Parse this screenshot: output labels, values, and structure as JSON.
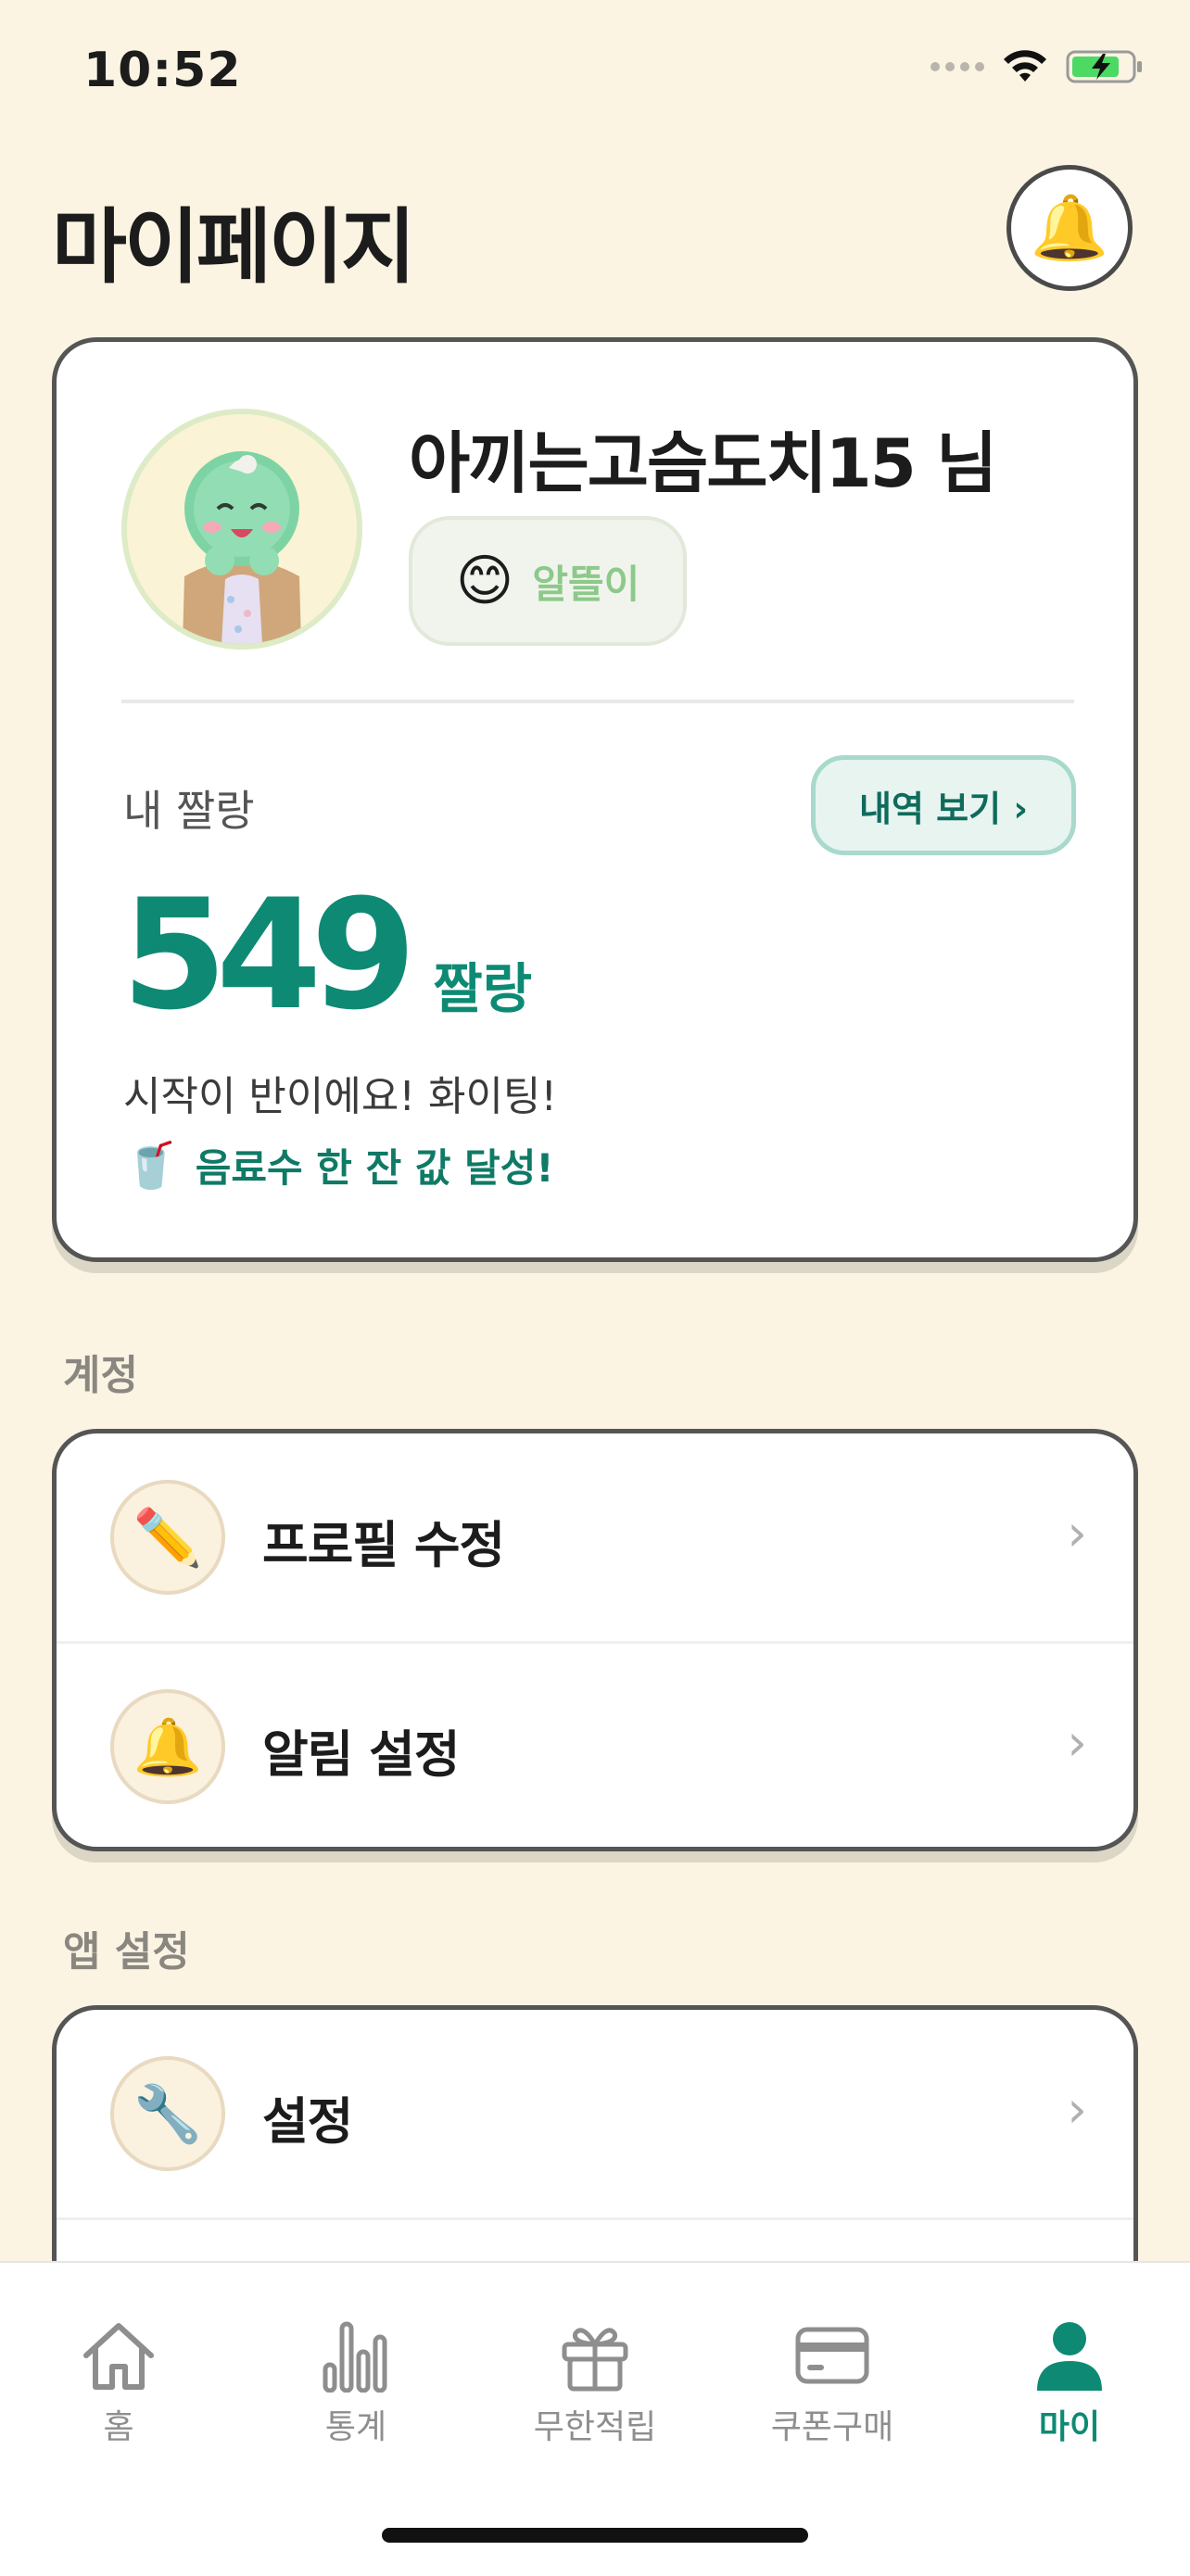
{
  "status_bar": {
    "time": "10:52"
  },
  "header": {
    "title": "마이페이지",
    "notification_icon": "bell-icon"
  },
  "profile": {
    "username": "아끼는고슴도치15 님",
    "badge_emoji": "😊",
    "badge_label": "알뜰이",
    "points_label": "내 짤랑",
    "history_button": "내역 보기 ›",
    "points_value": "549",
    "points_unit": "짤랑",
    "message": "시작이 반이에요! 화이팅!",
    "achievement_icon": "🥤",
    "achievement_text": "음료수 한 잔 값 달성!"
  },
  "sections": {
    "account": {
      "title": "계정",
      "items": [
        {
          "label": "프로필 수정",
          "icon": "✏️"
        },
        {
          "label": "알림 설정",
          "icon": "🔔"
        }
      ]
    },
    "app_settings": {
      "title": "앱 설정",
      "items": [
        {
          "label": "설정",
          "icon": "🔧"
        }
      ]
    }
  },
  "chevron": "›",
  "tabs": [
    {
      "label": "홈"
    },
    {
      "label": "통계"
    },
    {
      "label": "무한적립"
    },
    {
      "label": "쿠폰구매"
    },
    {
      "label": "마이"
    }
  ],
  "colors": {
    "accent": "#0E8A74",
    "background": "#FBF4E3",
    "badge_text": "#8CC98A"
  }
}
